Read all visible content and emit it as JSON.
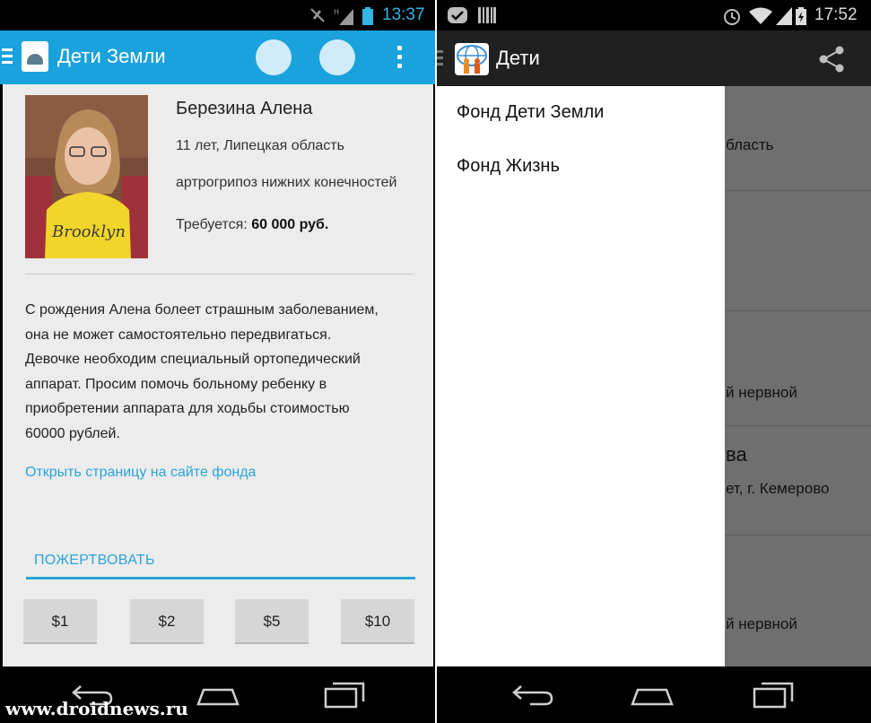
{
  "left_screen": {
    "status_bar": {
      "time": "13:37"
    },
    "app_bar": {
      "title": "Дети Земли"
    },
    "child": {
      "name": "Березина Алена",
      "age_region": "11 лет, Липецкая область",
      "diagnosis": "артрогрипоз нижних конечностей",
      "required_label": "Требуется:",
      "required_amount": "60 000 руб.",
      "photo_shirt_text": "Brooklyn"
    },
    "description": [
      "С рождения Алена болеет страшным заболеванием,",
      "она не может самостоятельно передвигаться.",
      "Девочке необходим специальный ортопедический",
      "аппарат. Просим помочь больному ребенку в",
      "приобретении аппарата для ходьбы стоимостью",
      "60000 рублей."
    ],
    "open_link": "Открыть страницу на сайте фонда",
    "donate_tab": "ПОЖЕРТВОВАТЬ",
    "amounts": [
      "$1",
      "$2",
      "$5",
      "$10"
    ]
  },
  "right_screen": {
    "status_bar": {
      "time": "17:52"
    },
    "app_bar": {
      "title": "Дети"
    },
    "drawer": {
      "items": [
        "Фонд Дети Земли",
        "Фонд Жизнь"
      ]
    },
    "behind_fragments": [
      "бласть",
      "й нервной",
      "ва",
      "ет, г. Кемерово",
      "й нервной"
    ]
  },
  "watermark": "www.droidnews.ru",
  "colors": {
    "accent": "#1aa2dc",
    "link": "#2ba4d9",
    "content_bg": "#ececec",
    "dark_bar": "#202020"
  },
  "icons": [
    "hamburger-icon",
    "android-app-icon",
    "overflow-menu-icon",
    "share-icon",
    "back-icon",
    "home-icon",
    "recents-icon",
    "clock-icon",
    "wifi-icon",
    "battery-icon",
    "signal-icon"
  ]
}
